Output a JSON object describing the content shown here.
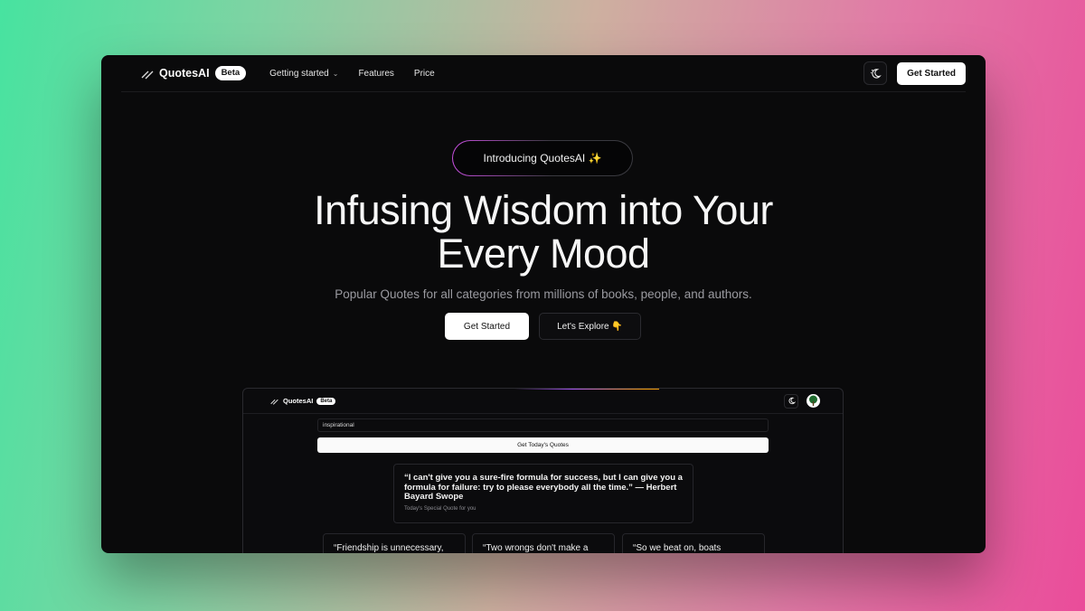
{
  "nav": {
    "brand": "QuotesAI",
    "badge": "Beta",
    "links": [
      {
        "label": "Getting started",
        "has_dropdown": true
      },
      {
        "label": "Features"
      },
      {
        "label": "Price"
      }
    ],
    "cta": "Get Started"
  },
  "hero": {
    "pill": "Introducing QuotesAI ✨",
    "headline_line1": "Infusing Wisdom into Your",
    "headline_line2": "Every Mood",
    "subheadline": "Popular Quotes for all categories from millions of books, people, and authors.",
    "primary_button": "Get Started",
    "secondary_button": "Let's Explore 👇"
  },
  "preview": {
    "brand": "QuotesAI",
    "badge": "Beta",
    "search_value": "inspirational",
    "button": "Get Today's Quotes",
    "featured_quote": "“I can't give you a sure-fire formula for success, but I can give you a formula for failure: try to please everybody all the time.” — Herbert Bayard Swope",
    "featured_caption": "Today's Special Quote for you",
    "cards": [
      "“Friendship is unnecessary,",
      "“Two wrongs don't make a",
      "“So we beat on, boats"
    ]
  },
  "colors": {
    "background_dark": "#0a0a0b",
    "accent_gradient_start": "#a855f7",
    "accent_gradient_end": "#f59e0b"
  },
  "icons": {
    "logo": "slash-logo-icon",
    "theme": "moon-sun-icon",
    "avatar": "tree-avatar-icon"
  }
}
